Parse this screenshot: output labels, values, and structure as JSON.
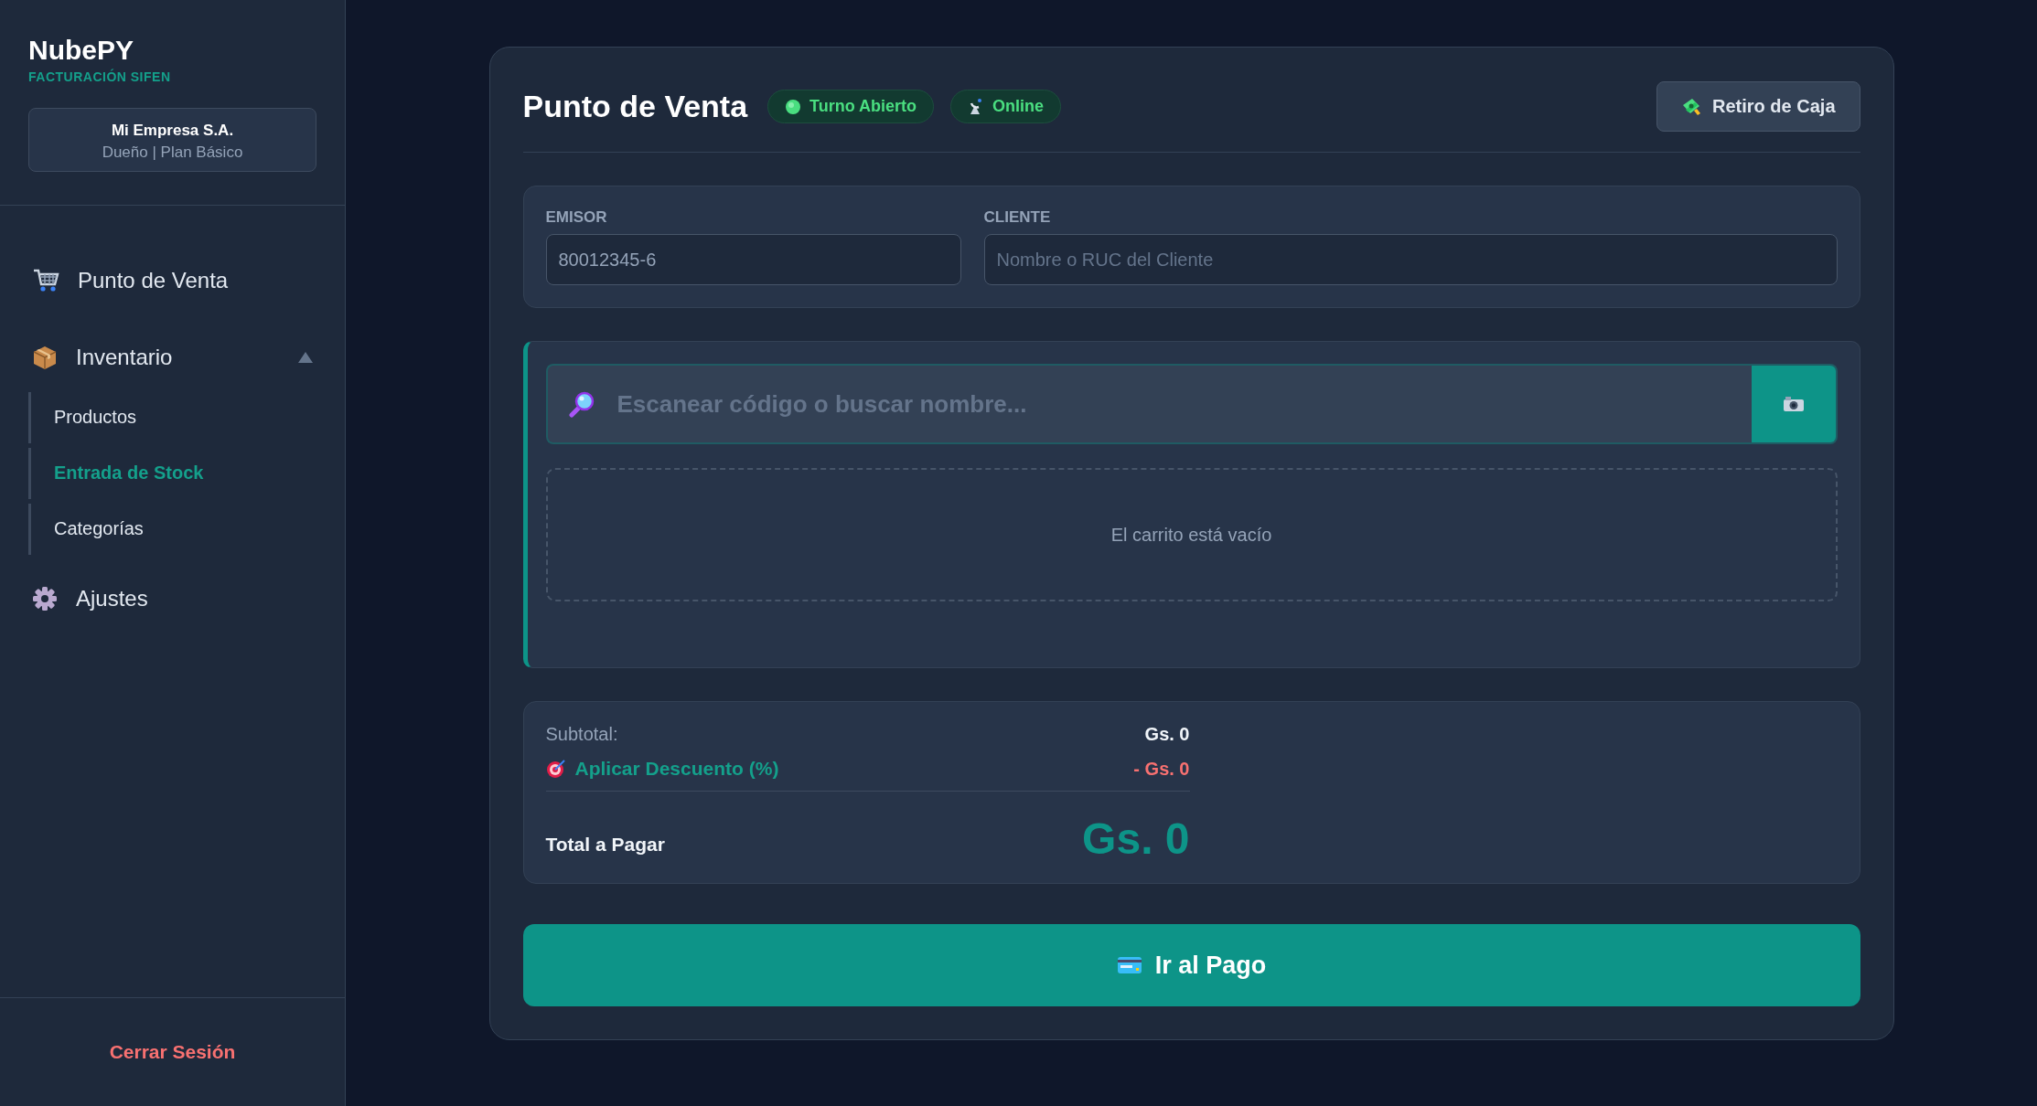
{
  "sidebar": {
    "brand": "NubePY",
    "tagline": "FACTURACIÓN SIFEN",
    "company": {
      "name": "Mi Empresa S.A.",
      "role": "Dueño | Plan Básico"
    },
    "nav": [
      {
        "label": "Punto de Venta",
        "selected": false
      },
      {
        "label": "Inventario",
        "selected": false,
        "expanded": true,
        "children": [
          {
            "label": "Productos",
            "selected": false
          },
          {
            "label": "Entrada de Stock",
            "selected": true
          },
          {
            "label": "Categorías",
            "selected": false
          }
        ]
      },
      {
        "label": "Ajustes",
        "selected": false
      }
    ],
    "logout": "Cerrar Sesión"
  },
  "main": {
    "title": "Punto de Venta",
    "badges": [
      {
        "label": "Turno Abierto",
        "kind": "dot"
      },
      {
        "label": "Online",
        "kind": "antenna"
      }
    ],
    "action": "Retiro de Caja",
    "fields": [
      {
        "label": "EMISOR",
        "value": "80012345-6"
      },
      {
        "label": "CLIENTE",
        "placeholder": "Nombre o RUC del Cliente"
      }
    ],
    "search": {
      "placeholder": "Escanear código o buscar nombre..."
    },
    "cart": {
      "empty_message": "El carrito está vacío"
    },
    "totals": {
      "subtotal_label": "Subtotal:",
      "subtotal": "Gs. 0",
      "discount_label": "Aplicar Descuento (%)",
      "discount": "- Gs. 0",
      "total_label": "Total a Pagar",
      "total": "Gs. 0"
    },
    "pay_button": "Ir al Pago"
  }
}
